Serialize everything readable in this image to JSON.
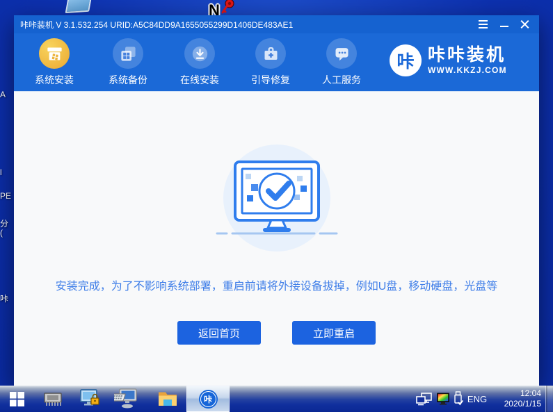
{
  "desktop": {
    "edge_labels": [
      "A",
      "l",
      "PE",
      "分(",
      "咔"
    ],
    "n_icon_letter": "N"
  },
  "window": {
    "titlebar": {
      "title": "咔咔装机 V 3.1.532.254 URID:A5C84DD9A1655055299D1406DE483AE1"
    },
    "nav": {
      "items": [
        {
          "label": "系统安装",
          "icon": "install-package-icon",
          "active": true
        },
        {
          "label": "系统备份",
          "icon": "backup-windows-icon",
          "active": false
        },
        {
          "label": "在线安装",
          "icon": "online-download-icon",
          "active": false
        },
        {
          "label": "引导修复",
          "icon": "boot-repair-toolbox-icon",
          "active": false
        },
        {
          "label": "人工服务",
          "icon": "support-chat-icon",
          "active": false
        }
      ],
      "logo": {
        "symbol": "咔",
        "title": "咔咔装机",
        "url": "WWW.KKZJ.COM"
      }
    },
    "content": {
      "message": "安装完成，为了不影响系统部署，重启前请将外接设备拔掉，例如U盘，移动硬盘，光盘等",
      "buttons": [
        {
          "label": "返回首页"
        },
        {
          "label": "立即重启"
        }
      ]
    }
  },
  "taskbar": {
    "app_symbol": "咔",
    "tray": {
      "lang": "ENG",
      "time": "12:04",
      "date": "2020/1/15"
    }
  },
  "colors": {
    "header_blue": "#1b69d7",
    "titlebar_blue": "#1562d0",
    "accent_blue": "#2f7ded",
    "active_gold": "#eeb33c",
    "desktop_blue": "#0d31b0",
    "message_blue": "#3f7ee8",
    "button_blue": "#1c63e0",
    "content_bg": "#f8f9fa",
    "hero_circle_bg": "#e8f1fc"
  }
}
